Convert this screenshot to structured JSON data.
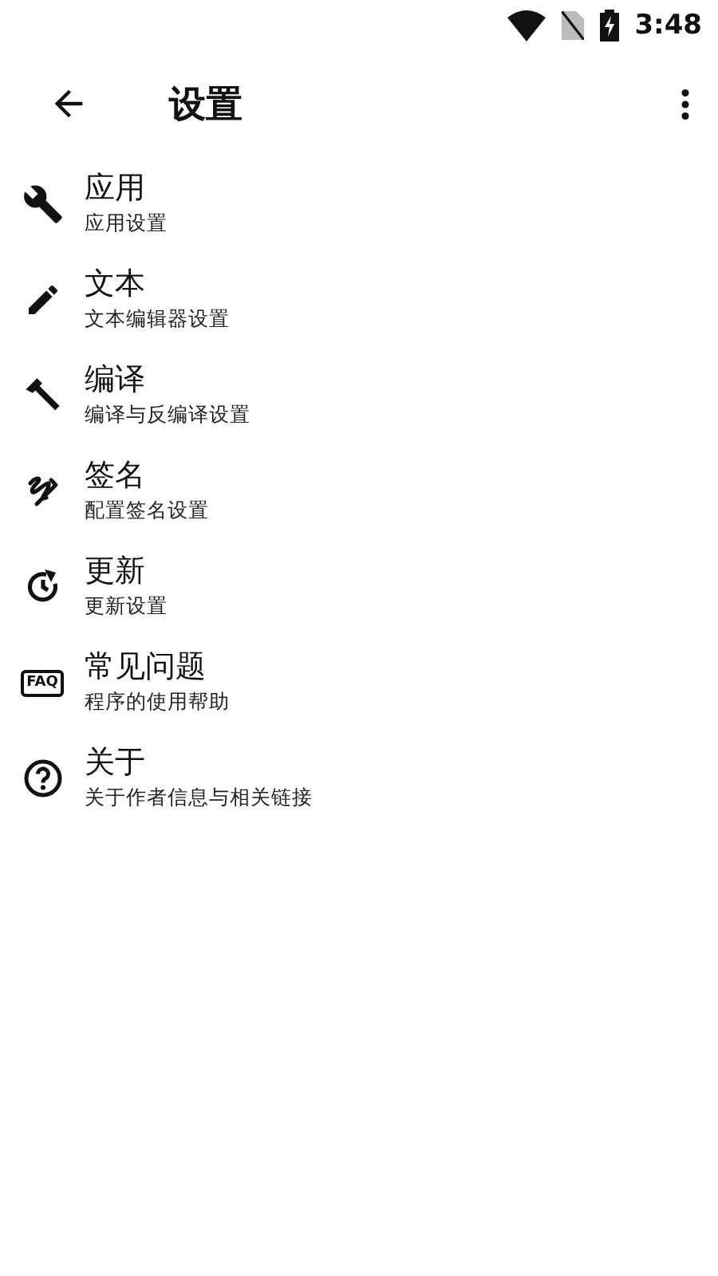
{
  "status_bar": {
    "time": "3:48"
  },
  "toolbar": {
    "title": "设置"
  },
  "items": [
    {
      "kind": "wrench",
      "title": "应用",
      "subtitle": "应用设置"
    },
    {
      "kind": "pencil",
      "title": "文本",
      "subtitle": "文本编辑器设置"
    },
    {
      "kind": "hammer",
      "title": "编译",
      "subtitle": "编译与反编译设置"
    },
    {
      "kind": "signature",
      "title": "签名",
      "subtitle": "配置签名设置"
    },
    {
      "kind": "update",
      "title": "更新",
      "subtitle": "更新设置"
    },
    {
      "kind": "faq",
      "icon_text": "FAQ",
      "title": "常见问题",
      "subtitle": "程序的使用帮助"
    },
    {
      "kind": "help",
      "title": "关于",
      "subtitle": "关于作者信息与相关链接"
    }
  ]
}
